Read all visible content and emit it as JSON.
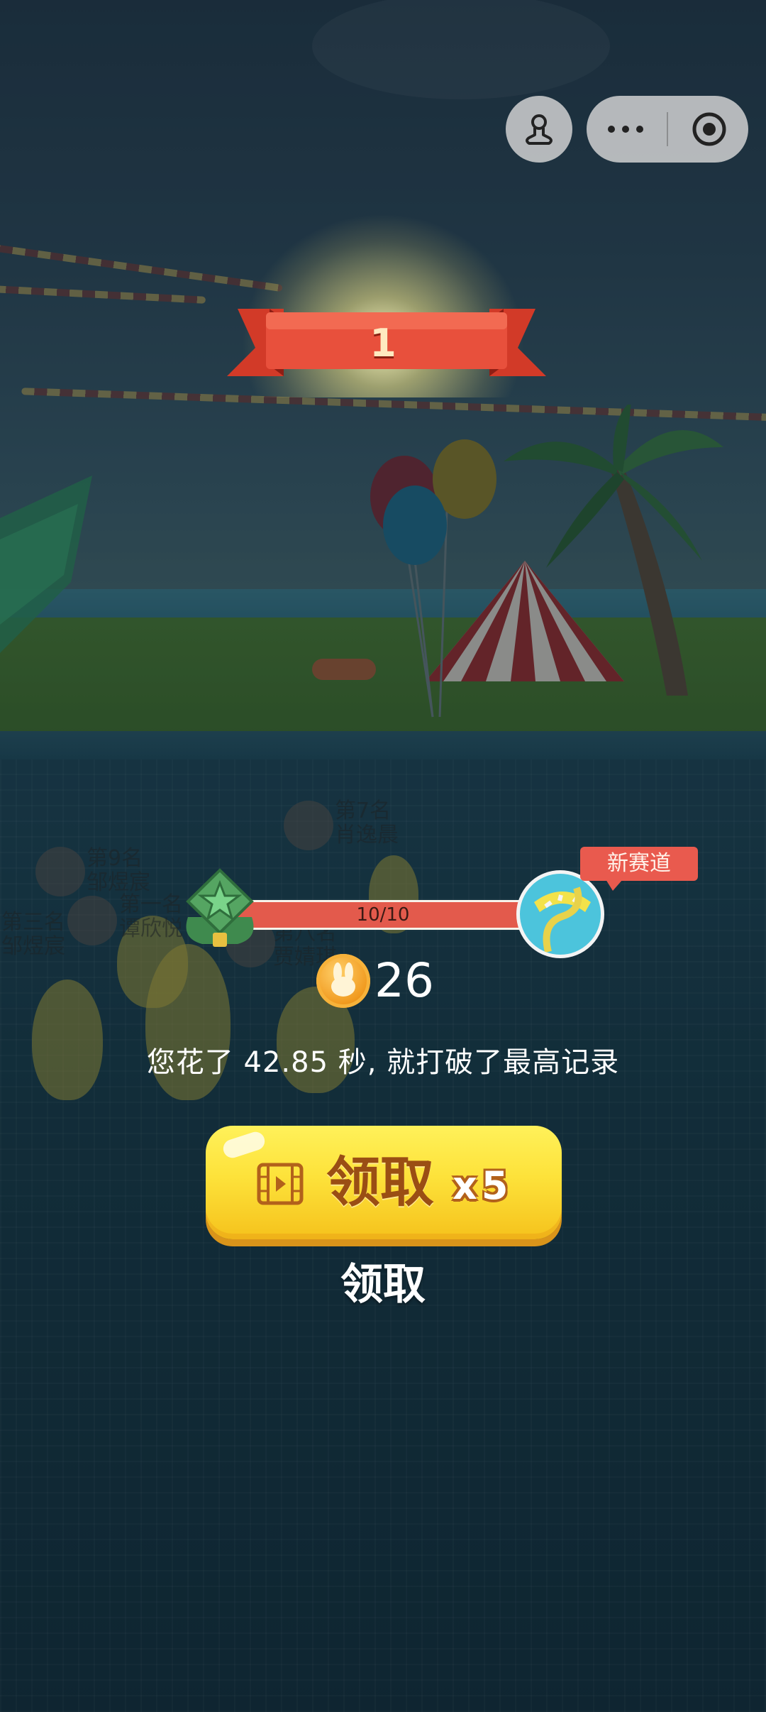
{
  "top_bar": {
    "mic_icon": "joystick-icon",
    "menu_icon": "more-dots-icon",
    "close_icon": "target-close-icon"
  },
  "rank": {
    "number": "1"
  },
  "background_players": [
    {
      "label": "第7名\n肖逸晨"
    },
    {
      "label": "第9名\n邹煜宸"
    },
    {
      "label": "第三名\n邹煜宸"
    },
    {
      "label": "第一名\n谭欣悦"
    },
    {
      "label": "第八名\n贾婧琪"
    }
  ],
  "progress": {
    "text": "10/10",
    "value": 1.0,
    "new_track_label": "新赛道"
  },
  "coins": {
    "icon": "rabbit-coin-icon",
    "count": "26"
  },
  "record_text": "您花了 42.85 秒, 就打破了最高记录",
  "buttons": {
    "claim_x5_label": "领取",
    "claim_x5_multiplier": "x5",
    "claim_plain_label": "领取"
  },
  "colors": {
    "banner_red": "#e8503c",
    "progress_red": "#e2584b",
    "button_yellow": "#fde23a",
    "coin_orange": "#f19a1f"
  }
}
